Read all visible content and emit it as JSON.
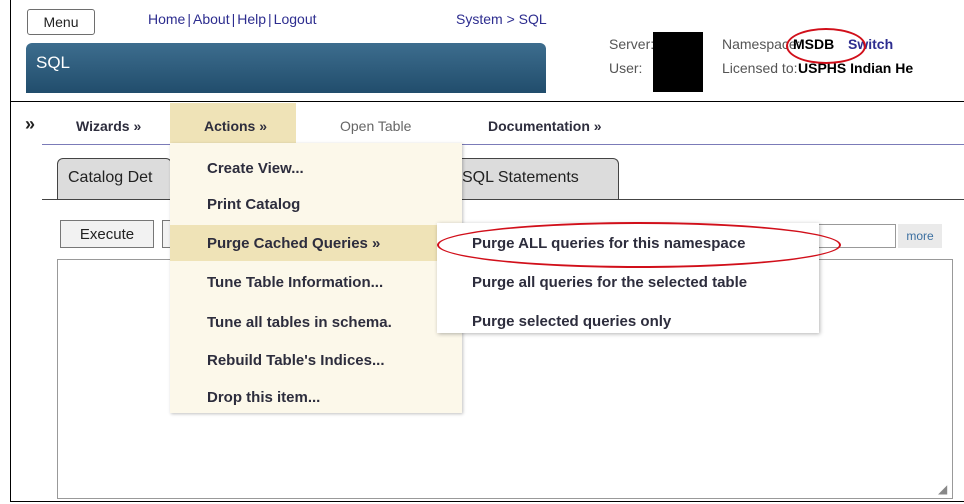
{
  "header": {
    "menu_label": "Menu",
    "links": [
      "Home",
      "About",
      "Help",
      "Logout"
    ],
    "breadcrumb": "System > SQL",
    "app_title": "SQL",
    "server_label": "Server:",
    "user_label": "User:",
    "namespace_label": "Namespace:",
    "namespace_value": "MSDB",
    "switch_label": "Switch",
    "licensed_label": "Licensed to:",
    "licensed_value": "USPHS Indian He"
  },
  "nav": {
    "expand_icon": "»",
    "wizards": "Wizards »",
    "actions": "Actions »",
    "open_table": "Open Table",
    "documentation": "Documentation »"
  },
  "tabs": {
    "catalog": "Catalog Det",
    "sql_statements": "SQL Statements"
  },
  "toolbar": {
    "execute": "Execute",
    "more": "more"
  },
  "actions_menu": {
    "items": [
      "Create View...",
      "Print Catalog",
      "Purge Cached Queries »",
      "Tune Table Information...",
      "Tune all tables in schema.",
      "Rebuild Table's Indices...",
      "Drop this item..."
    ]
  },
  "purge_submenu": {
    "items": [
      "Purge ALL queries for this namespace",
      "Purge all queries for the selected table",
      "Purge selected queries only"
    ]
  },
  "colors": {
    "banner": "#214d6c",
    "link": "#2d2d8f",
    "highlight": "#efe3b7",
    "annotation": "#d10f1a"
  }
}
